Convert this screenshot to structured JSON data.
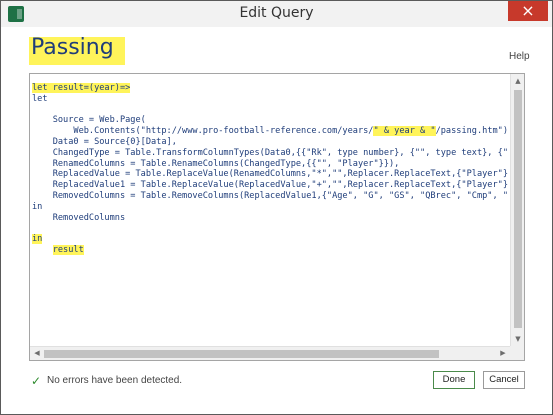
{
  "window": {
    "title": "Edit Query",
    "app_icon": "excel-icon",
    "close_glyph": "×"
  },
  "query": {
    "name": "Passing",
    "help_link": "Help"
  },
  "editor": {
    "lines": [
      {
        "pre": "",
        "hl": "let result=(year)=>",
        "post": ""
      },
      {
        "pre": "let",
        "hl": "",
        "post": ""
      },
      {
        "pre": "",
        "hl": "",
        "post": ""
      },
      {
        "pre": "    Source = Web.Page(",
        "hl": "",
        "post": ""
      },
      {
        "pre": "        Web.Contents(\"http://www.pro-football-reference.com/years/",
        "hl": "\" & year & \"",
        "post": "/passing.htm\")),"
      },
      {
        "pre": "    Data0 = Source{0}[Data],",
        "hl": "",
        "post": ""
      },
      {
        "pre": "    ChangedType = Table.TransformColumnTypes(Data0,{{\"Rk\", type number}, {\"\", type text}, {\"Tm\", t",
        "hl": "",
        "post": ""
      },
      {
        "pre": "    RenamedColumns = Table.RenameColumns(ChangedType,{{\"\", \"Player\"}}),",
        "hl": "",
        "post": ""
      },
      {
        "pre": "    ReplacedValue = Table.ReplaceValue(RenamedColumns,\"*\",\"\",Replacer.ReplaceText,{\"Player\"}),",
        "hl": "",
        "post": ""
      },
      {
        "pre": "    ReplacedValue1 = Table.ReplaceValue(ReplacedValue,\"+\",\"\",Replacer.ReplaceText,{\"Player\"}),",
        "hl": "",
        "post": ""
      },
      {
        "pre": "    RemovedColumns = Table.RemoveColumns(ReplacedValue1,{\"Age\", \"G\", \"GS\", \"QBrec\", \"Cmp\", \"Att\",",
        "hl": "",
        "post": ""
      },
      {
        "pre": "in",
        "hl": "",
        "post": ""
      },
      {
        "pre": "    RemovedColumns",
        "hl": "",
        "post": ""
      },
      {
        "pre": "",
        "hl": "",
        "post": ""
      },
      {
        "pre": "",
        "hl": "in",
        "post": ""
      },
      {
        "pre": "    ",
        "hl": "result",
        "post": ""
      }
    ],
    "scroll_up_glyph": "▲",
    "scroll_down_glyph": "▼",
    "scroll_left_glyph": "◀",
    "scroll_right_glyph": "▶"
  },
  "status": {
    "icon": "checkmark-icon",
    "glyph": "✓",
    "text": "No errors have been detected."
  },
  "buttons": {
    "done": "Done",
    "cancel": "Cancel"
  },
  "colors": {
    "highlight": "#fff45a",
    "code_text": "#1f3d7a",
    "close_button": "#c7392b",
    "status_ok": "#2e8b2e"
  }
}
